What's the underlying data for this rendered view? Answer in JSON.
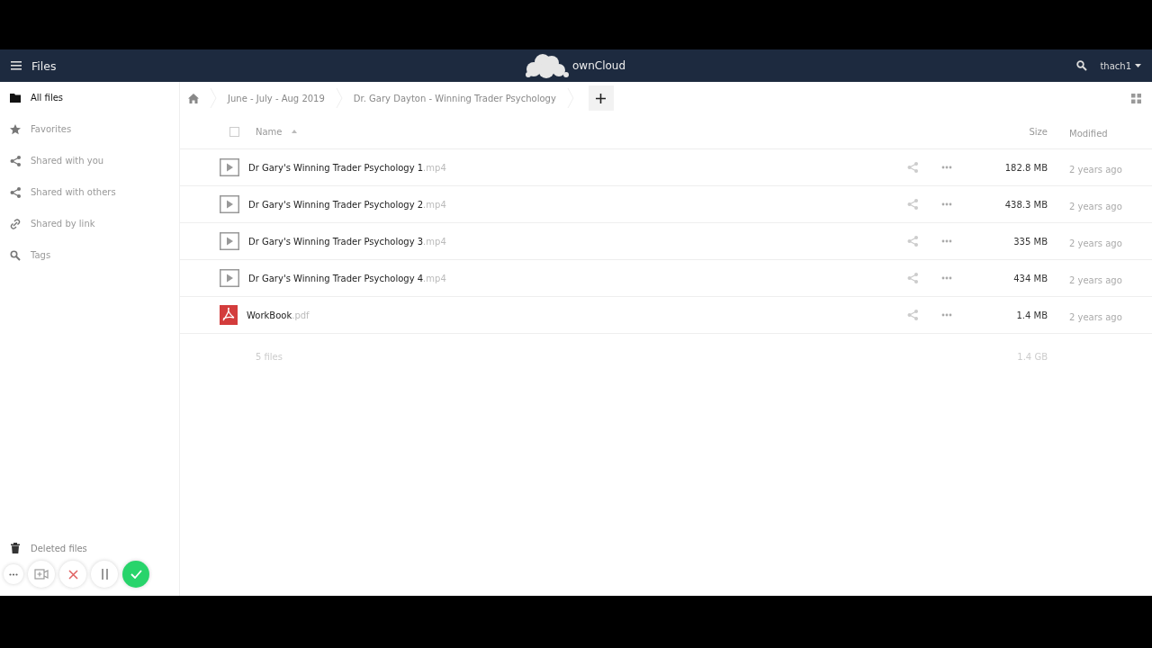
{
  "header": {
    "app_title": "Files",
    "brand": "ownCloud",
    "user": "thach1"
  },
  "sidebar": {
    "items": [
      {
        "label": "All files",
        "selected": true
      },
      {
        "label": "Favorites",
        "selected": false
      },
      {
        "label": "Shared with you",
        "selected": false
      },
      {
        "label": "Shared with others",
        "selected": false
      },
      {
        "label": "Shared by link",
        "selected": false
      },
      {
        "label": "Tags",
        "selected": false
      }
    ],
    "footer_items": [
      {
        "label": "Deleted files"
      }
    ]
  },
  "breadcrumbs": [
    "June - July - Aug 2019",
    "Dr. Gary Dayton - Winning Trader Psychology"
  ],
  "table": {
    "columns": [
      "Name",
      "Size",
      "Modified"
    ],
    "select_all_checked": false,
    "rows": [
      {
        "kind": "video",
        "name": "Dr Gary's Winning Trader Psychology 1.mp4",
        "size": "182.8 MB",
        "modified": "2 years ago"
      },
      {
        "kind": "video",
        "name": "Dr Gary's Winning Trader Psychology 2.mp4",
        "size": "438.3 MB",
        "modified": "2 years ago"
      },
      {
        "kind": "video",
        "name": "Dr Gary's Winning Trader Psychology 3.mp4",
        "size": "335 MB",
        "modified": "2 years ago"
      },
      {
        "kind": "video",
        "name": "Dr Gary's Winning Trader Psychology 4.mp4",
        "size": "434 MB",
        "modified": "2 years ago"
      },
      {
        "kind": "pdf",
        "name": "WorkBook.pdf",
        "size": "1.4 MB",
        "modified": "2 years ago"
      }
    ],
    "summary": {
      "count": "5 files",
      "size": "1.4 GB"
    }
  }
}
